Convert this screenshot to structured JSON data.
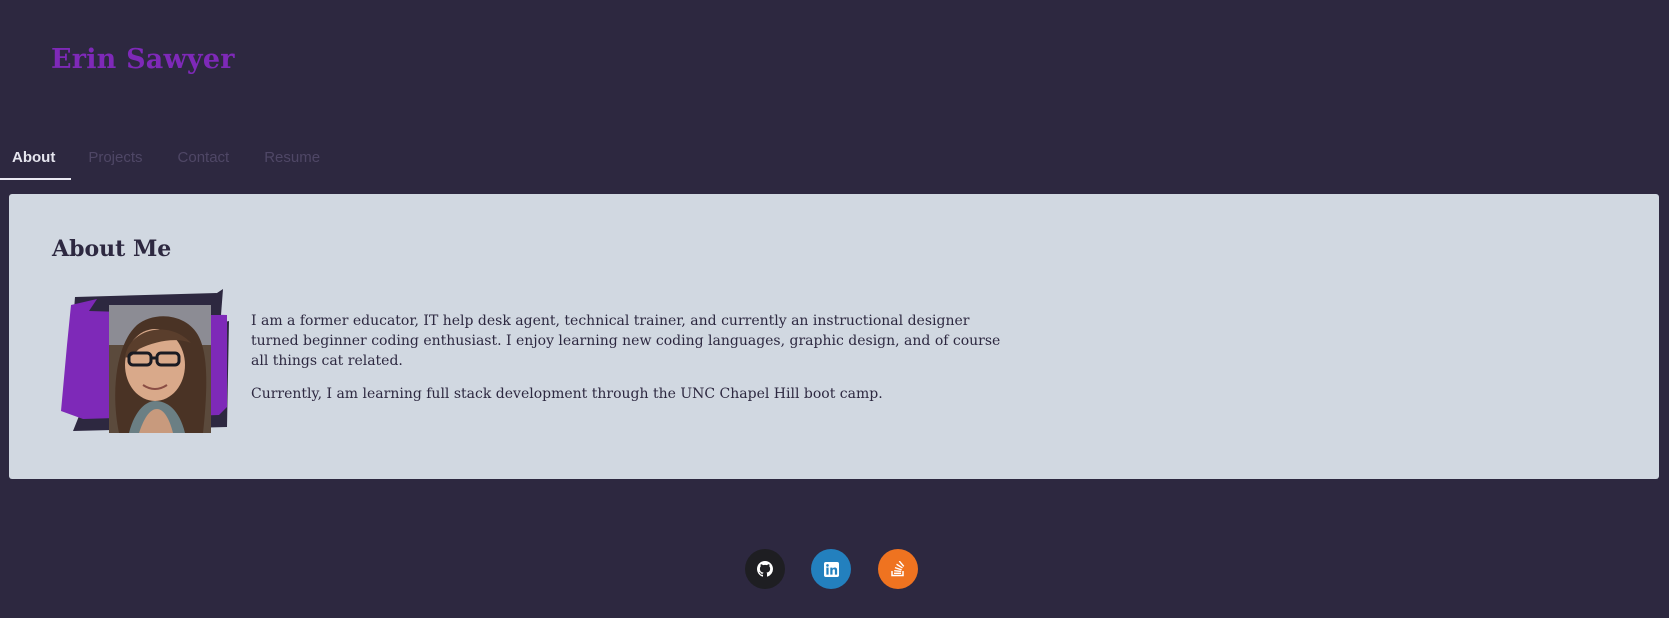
{
  "header": {
    "title": "Erin Sawyer"
  },
  "nav": {
    "tabs": [
      {
        "label": "About",
        "active": true
      },
      {
        "label": "Projects",
        "active": false
      },
      {
        "label": "Contact",
        "active": false
      },
      {
        "label": "Resume",
        "active": false
      }
    ]
  },
  "about": {
    "heading": "About Me",
    "photo_alt": "Erin Sawyer portrait",
    "paragraphs": [
      "I am a former educator, IT help desk agent, technical trainer, and currently an instructional designer turned beginner coding enthusiast. I enjoy learning new coding languages, graphic design, and of course all things cat related.",
      "Currently, I am learning full stack development through the UNC Chapel Hill boot camp."
    ]
  },
  "footer": {
    "social": [
      {
        "name": "GitHub",
        "icon": "github-icon",
        "color": "#1e1e22"
      },
      {
        "name": "LinkedIn",
        "icon": "linkedin-icon",
        "color": "#2380be"
      },
      {
        "name": "Stack Overflow",
        "icon": "stackoverflow-icon",
        "color": "#ef7320"
      }
    ]
  },
  "colors": {
    "background": "#2d2840",
    "accent": "#7e29b8",
    "card": "#d1d8e1"
  }
}
